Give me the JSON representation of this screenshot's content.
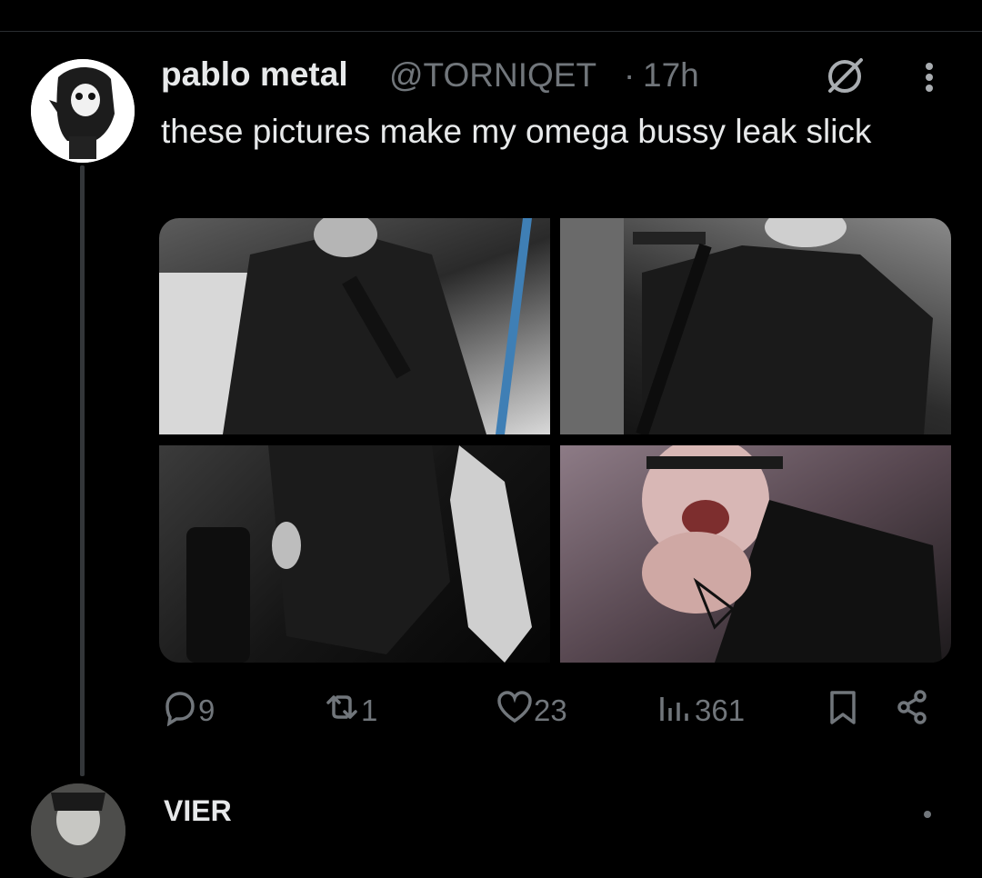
{
  "tweet": {
    "author_name": "pablo metal",
    "author_handle": "@TORNIQET",
    "separator": "·",
    "time": "17h",
    "text": "these pictures make my omega bussy leak slick"
  },
  "actions": {
    "replies": "9",
    "retweets": "1",
    "likes": "23",
    "views": "361"
  },
  "next_tweet": {
    "author_name": "VIER"
  },
  "colors": {
    "background": "#000000",
    "text": "#e7e9ea",
    "muted": "#71767b",
    "divider": "#2a2d31"
  },
  "icons": [
    "grok-icon",
    "more-icon",
    "reply-icon",
    "retweet-icon",
    "like-icon",
    "views-icon",
    "bookmark-icon",
    "share-icon"
  ]
}
